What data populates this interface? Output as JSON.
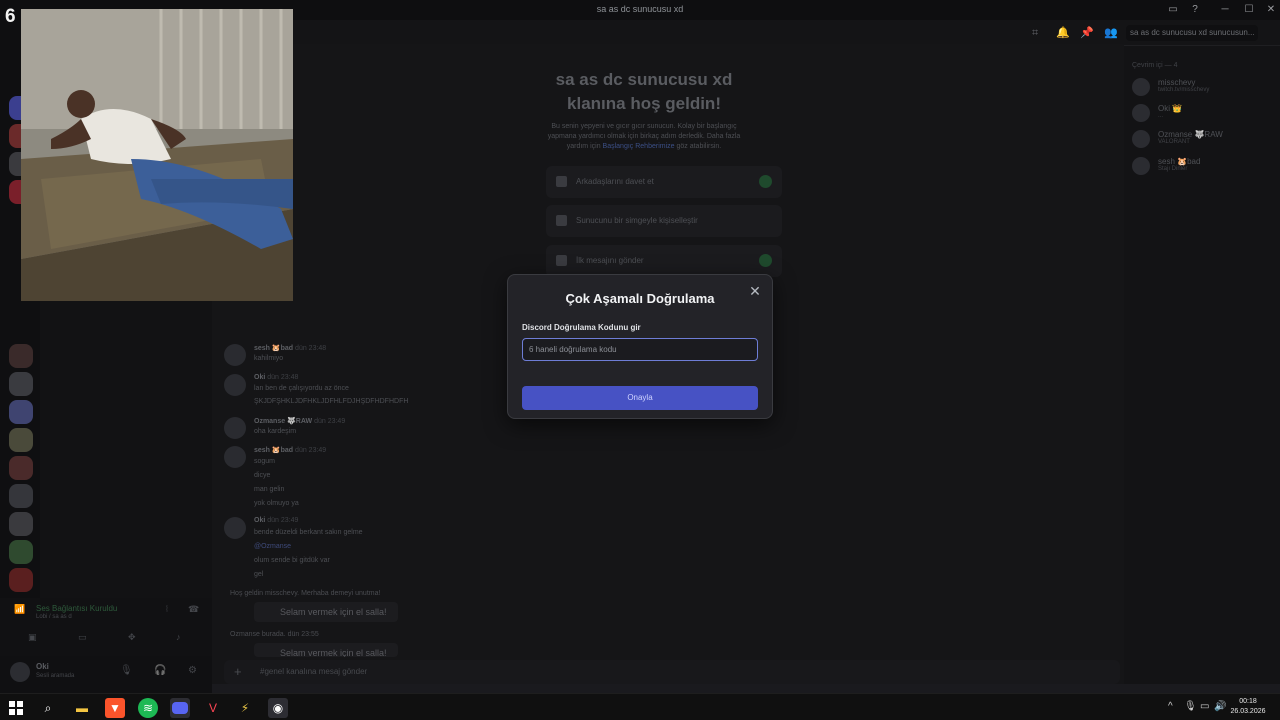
{
  "overlay": {
    "number": "6"
  },
  "window": {
    "title": "sa as dc sunucusu xd",
    "minimize": "─",
    "maximize": "☐",
    "close": "✕"
  },
  "topbar": {
    "search_placeholder": "sa as dc sunucusu xd sunucusun..."
  },
  "welcome": {
    "title_line1": "sa as dc sunucusu xd",
    "title_line2": "klanına hoş geldin!",
    "desc_line1": "Bu senin yepyeni ve gıcır gıcır sunucun. Kolay bir başlangıç",
    "desc_line2": "yapmana yardımcı olmak için birkaç adım derledik. Daha fazla",
    "desc_prefix": "yardım için ",
    "desc_link": "Başlangıç Rehberimize",
    "desc_suffix": " göz atabilirsin.",
    "items": [
      {
        "label": "Arkadaşlarını davet et"
      },
      {
        "label": "Sunucunu bir simgeyle kişiselleştir"
      },
      {
        "label": "İlk mesajını gönder"
      }
    ]
  },
  "messages": [
    {
      "author": "sesh",
      "tag": "🐹bad",
      "time": "dün 23:48",
      "lines": [
        "kahilmiyo"
      ]
    },
    {
      "author": "Oki",
      "tag": "",
      "time": "dün 23:48",
      "lines": [
        "lan ben de çalışıyordu az önce",
        "ŞKJDFŞHKLJDFHKLJDFHLFDJHŞDFHDFHDFH"
      ]
    },
    {
      "author": "Ozmanse",
      "tag": "🐺RAW",
      "time": "dün 23:49",
      "lines": [
        "oha kardeşim"
      ]
    },
    {
      "author": "sesh",
      "tag": "🐹bad",
      "time": "dün 23:49",
      "lines": [
        "sogum",
        "dicye",
        "man gelin",
        "yok olmuyo ya"
      ]
    },
    {
      "author": "Oki",
      "tag": "",
      "time": "dün 23:49",
      "lines": [
        "bende düzeldi berkant sakın gelme",
        "@Ozmanse",
        "olum sende bi gitdük var",
        "gel"
      ]
    }
  ],
  "system_messages": [
    {
      "text": "Hoş geldin misschevy. Merhaba demeyi unutma!"
    },
    {
      "text": "Ozmanse burada. dün 23:55"
    }
  ],
  "wave_button": "Selam vermek için el salla!",
  "composer": {
    "placeholder": "#genel kanalına mesaj gönder"
  },
  "members": {
    "header": "Çevrim içi — 4",
    "list": [
      {
        "name": "misschevy",
        "status": "twitch.tv/misschevy"
      },
      {
        "name": "Oki 👑",
        "status": "..."
      },
      {
        "name": "Ozmanse 🐺RAW",
        "status": "VALORANT"
      },
      {
        "name": "sesh 🐹bad",
        "status": "Stajı Dinler"
      }
    ]
  },
  "voice": {
    "status": "Ses Bağlantısı Kuruldu",
    "channel": "Lobi / sa as d"
  },
  "user": {
    "name": "Oki",
    "status": "Sesli aramada"
  },
  "modal": {
    "title": "Çok Aşamalı Doğrulama",
    "close": "✕",
    "field_label": "Discord Doğrulama Kodunu gir",
    "placeholder": "6 haneli doğrulama kodu",
    "confirm": "Onayla"
  },
  "clock": {
    "time": "00:18",
    "date": "26.03.2026"
  },
  "colors": {
    "accent": "#4752c4",
    "input_focus": "#6e7dd6",
    "online": "#23a559"
  }
}
